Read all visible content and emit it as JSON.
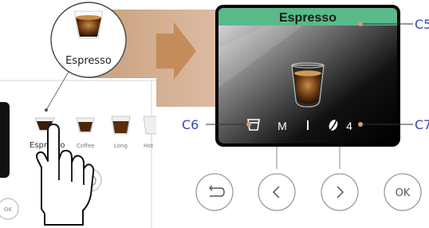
{
  "machine_panel": {
    "drinks": [
      {
        "label": "Espresso"
      },
      {
        "label": "Coffee"
      },
      {
        "label": "Long"
      },
      {
        "label": "Hot"
      }
    ],
    "buttons": {
      "ok_label": "OK"
    }
  },
  "callout": {
    "label": "Espresso"
  },
  "display": {
    "title": "Espresso",
    "size": "M",
    "strength": "4",
    "header_color": "#5aba8a"
  },
  "annotations": {
    "c5": "C5",
    "c6": "C6",
    "c7": "C7"
  },
  "nav_buttons": {
    "back": "back-icon",
    "left": "chevron-left-icon",
    "right": "chevron-right-icon",
    "ok_label": "OK"
  },
  "colors": {
    "annotation": "#3a48b5",
    "arrow": "#c48c5a",
    "arrow_band": "#d9b59a"
  }
}
